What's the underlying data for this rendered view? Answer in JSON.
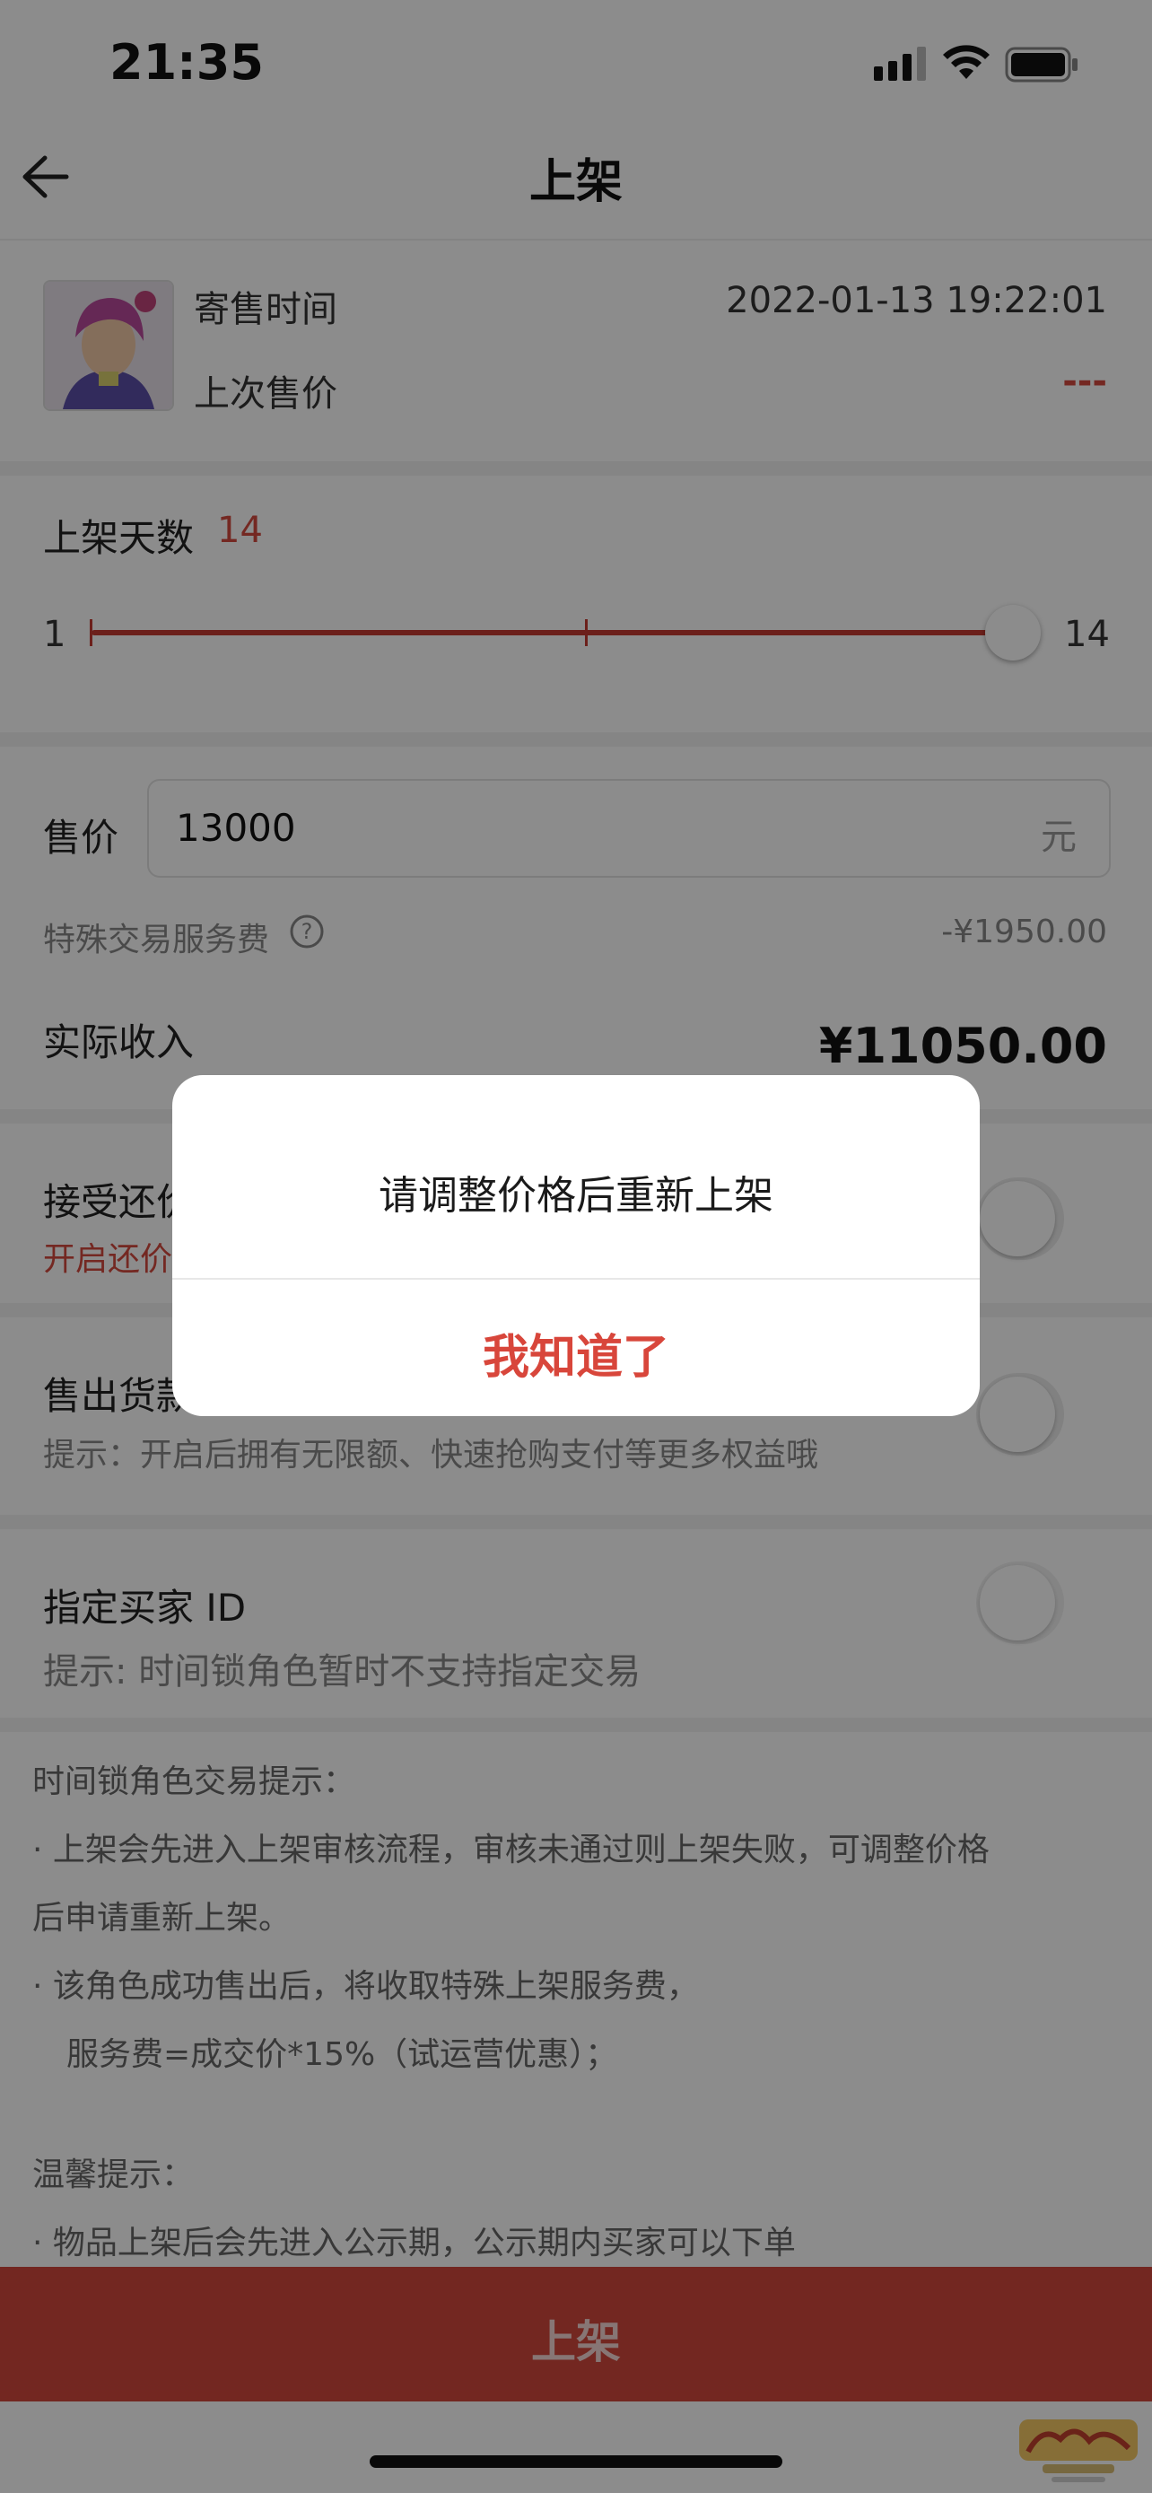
{
  "status_bar": {
    "time": "21:35"
  },
  "nav": {
    "title": "上架"
  },
  "item": {
    "consign_time_label": "寄售时间",
    "consign_time_value": "2022-01-13 19:22:01",
    "last_price_label": "上次售价",
    "last_price_value": "---"
  },
  "listing_days": {
    "label": "上架天数",
    "value": "14",
    "min": "1",
    "max": "14",
    "slider_value": 14
  },
  "price": {
    "label": "售价",
    "value": "13000",
    "unit": "元",
    "service_fee_label": "特殊交易服务费",
    "service_fee_value": "-¥1950.00",
    "income_label": "实际收入",
    "income_value": "¥11050.00"
  },
  "options": {
    "counter_offer_label": "接受还价",
    "counter_offer_sub": "开启还价",
    "payout_label": "售出货款",
    "payout_hint": "提示：开启后拥有无限额、快速抢购支付等更多权益哦",
    "buyer_id_label": "指定买家 ID",
    "buyer_id_hint": "提示: 时间锁角色暂时不支持指定交易"
  },
  "notes": {
    "title1": "时间锁角色交易提示：",
    "line1": "· 上架会先进入上架审核流程，审核未通过则上架失败，可调整价格",
    "line2": "后申请重新上架。",
    "line3": "· 该角色成功售出后，将收取特殊上架服务费，",
    "line4": "服务费=成交价*15%（试运营优惠）；",
    "title2": "温馨提示：",
    "line5": "· 物品上架后会先进入公示期，公示期内买家可以下单"
  },
  "cta": {
    "label": "上架"
  },
  "dialog": {
    "message": "请调整价格后重新上架",
    "button": "我知道了"
  },
  "colors": {
    "accent": "#d8463b",
    "cta": "#d1473d"
  }
}
